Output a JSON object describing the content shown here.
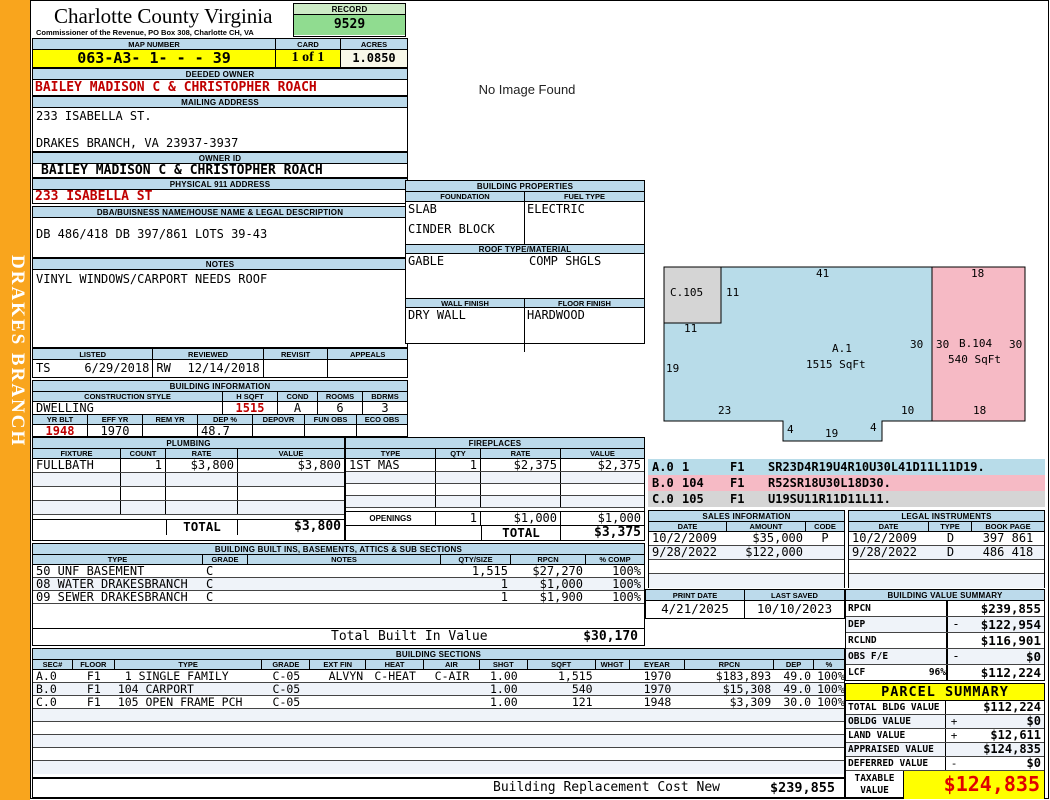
{
  "district": "DRAKES BRANCH",
  "no_image_text": "No Image Found",
  "header": {
    "county": "Charlotte County Virginia",
    "commissioner": "Commissioner of the Revenue, PO Box 308, Charlotte CH, VA",
    "record_label": "RECORD",
    "record_value": "9529",
    "map_label": "MAP NUMBER",
    "map_value": "063-A3- 1-  -  - 39",
    "card_label": "CARD",
    "card_value": "1 of 1",
    "acres_label": "ACRES",
    "acres_value": "1.0850"
  },
  "owner": {
    "deeded_label": "DEEDED OWNER",
    "deeded_value": "BAILEY MADISON C & CHRISTOPHER ROACH",
    "mailing_label": "MAILING ADDRESS",
    "mailing_line1": "233 ISABELLA ST.",
    "mailing_line2": "DRAKES BRANCH, VA 23937-3937",
    "owner_id_label": "OWNER ID",
    "owner_id_value": "BAILEY MADISON C & CHRISTOPHER ROACH",
    "physical_label": "PHYSICAL 911 ADDRESS",
    "physical_value": "233 ISABELLA ST",
    "legal_label": "DBA/BUISNESS NAME/HOUSE NAME & LEGAL DESCRIPTION",
    "legal_value": "DB 486/418 DB 397/861 LOTS 39-43",
    "notes_label": "NOTES",
    "notes_value": "VINYL WINDOWS/CARPORT NEEDS ROOF"
  },
  "visits": {
    "listed_label": "LISTED",
    "reviewed_label": "REVIEWED",
    "revisit_label": "REVISIT",
    "appeals_label": "APPEALS",
    "listed_by": "TS",
    "listed_date": "6/29/2018",
    "reviewed_by": "RW",
    "reviewed_date": "12/14/2018",
    "revisit_value": "",
    "appeals_value": ""
  },
  "building_info": {
    "band": "BUILDING INFORMATION",
    "style_label": "CONSTRUCTION STYLE",
    "hsqft_label": "H SQFT",
    "cond_label": "COND",
    "rooms_label": "ROOMS",
    "bdrms_label": "BDRMS",
    "style": "DWELLING",
    "hsqft": "1515",
    "cond": "A",
    "rooms": "6",
    "bdrms": "3",
    "yrblt_label": "YR BLT",
    "effyr_label": "EFF YR",
    "remyr_label": "REM YR",
    "dep_label": "DEP %",
    "depovr_label": "DEPOVR",
    "funobs_label": "FUN OBS",
    "ecoobs_label": "ECO OBS",
    "yrblt": "1948",
    "effyr": "1970",
    "remyr": "",
    "dep": "48.7",
    "depovr": "",
    "funobs": "",
    "ecoobs": ""
  },
  "plumbing": {
    "band": "PLUMBING",
    "headers": [
      "FIXTURE",
      "COUNT",
      "RATE",
      "VALUE"
    ],
    "rows": [
      {
        "fixture": "FULLBATH",
        "count": "1",
        "rate": "$3,800",
        "value": "$3,800"
      }
    ],
    "total_label": "TOTAL",
    "total_value": "$3,800"
  },
  "fireplaces": {
    "band": "FIREPLACES",
    "headers": [
      "TYPE",
      "QTY",
      "RATE",
      "VALUE"
    ],
    "rows": [
      {
        "type": "1ST MAS",
        "qty": "1",
        "rate": "$2,375",
        "value": "$2,375"
      }
    ],
    "openings_label": "OPENINGS",
    "openings_qty": "1",
    "openings_rate": "$1,000",
    "openings_value": "$1,000",
    "total_label": "TOTAL",
    "total_value": "$3,375"
  },
  "building_properties": {
    "band": "BUILDING PROPERTIES",
    "foundation_label": "FOUNDATION",
    "fuel_label": "FUEL TYPE",
    "foundation_line1": "SLAB",
    "foundation_line2": "CINDER BLOCK",
    "fuel": "ELECTRIC",
    "roof_label": "ROOF TYPE/MATERIAL",
    "roof_type": "GABLE",
    "roof_material": "COMP SHGLS",
    "wall_label": "WALL FINISH",
    "floor_label": "FLOOR FINISH",
    "wall": "DRY WALL",
    "floor": "HARDWOOD"
  },
  "built_ins": {
    "band": "BUILDING BUILT INS, BASEMENTS, ATTICS & SUB SECTIONS",
    "headers": [
      "TYPE",
      "GRADE",
      "NOTES",
      "QTY/SIZE",
      "RPCN",
      "% COMP"
    ],
    "rows": [
      {
        "type": "50 UNF BASEMENT",
        "grade": "C",
        "notes": "",
        "qty": "1,515",
        "rpcn": "$27,270",
        "comp": "100%"
      },
      {
        "type": "08 WATER DRAKESBRANCH",
        "grade": "C",
        "notes": "",
        "qty": "1",
        "rpcn": "$1,000",
        "comp": "100%"
      },
      {
        "type": "09 SEWER DRAKESBRANCH",
        "grade": "C",
        "notes": "",
        "qty": "1",
        "rpcn": "$1,900",
        "comp": "100%"
      }
    ],
    "total_label": "Total Built In Value",
    "total_value": "$30,170"
  },
  "sections": {
    "band": "BUILDING SECTIONS",
    "headers": [
      "SEC#",
      "FLOOR",
      "TYPE",
      "GRADE",
      "EXT FIN",
      "HEAT",
      "AIR",
      "SHGT",
      "SQFT",
      "WHGT",
      "EYEAR",
      "RPCN",
      "DEP",
      "% COMP"
    ],
    "rows": [
      {
        "sec": "A.0",
        "floor": "F1",
        "type": "1 SINGLE FAMILY",
        "grade": "C-05",
        "ext": "ALVYN",
        "heat": "C-HEAT",
        "air": "C-AIR",
        "shgt": "1.00",
        "sqft": "1,515",
        "whgt": "",
        "eyear": "1970",
        "rpcn": "$183,893",
        "dep": "49.0",
        "comp": "100%"
      },
      {
        "sec": "B.0",
        "floor": "F1",
        "type": "104 CARPORT",
        "grade": "C-05",
        "ext": "",
        "heat": "",
        "air": "",
        "shgt": "1.00",
        "sqft": "540",
        "whgt": "",
        "eyear": "1970",
        "rpcn": "$15,308",
        "dep": "49.0",
        "comp": "100%"
      },
      {
        "sec": "C.0",
        "floor": "F1",
        "type": "105 OPEN FRAME PCH",
        "grade": "C-05",
        "ext": "",
        "heat": "",
        "air": "",
        "shgt": "1.00",
        "sqft": "121",
        "whgt": "",
        "eyear": "1948",
        "rpcn": "$3,309",
        "dep": "30.0",
        "comp": "100%"
      }
    ]
  },
  "replacement": {
    "label": "Building Replacement Cost New",
    "value": "$239,855"
  },
  "sketch": {
    "a_label": "A.1",
    "a_sqft": "1515 SqFt",
    "b_label": "B.104",
    "b_sqft": "540 SqFt",
    "c_label": "C.105",
    "dims": {
      "top_a": "41",
      "top_b": "18",
      "c_right": "11",
      "c_bottom": "11",
      "a_left": "19",
      "a_right": "30",
      "b_left": "30",
      "b_right": "30",
      "a_bottom_left": "23",
      "a_bottom_right": "10",
      "b_bottom": "18",
      "notch_left": "4",
      "notch_bottom": "19",
      "notch_right": "4"
    }
  },
  "vectors": [
    {
      "sec": "A.0",
      "code": "1",
      "floor": "F1",
      "path": "SR23D4R19U4R10U30L41D11L11D19."
    },
    {
      "sec": "B.0",
      "code": "104",
      "floor": "F1",
      "path": "R52SR18U30L18D30."
    },
    {
      "sec": "C.0",
      "code": "105",
      "floor": "F1",
      "path": "U19SU11R11D11L11."
    }
  ],
  "sales": {
    "band": "SALES INFORMATION",
    "headers": [
      "DATE",
      "AMOUNT",
      "CODE"
    ],
    "rows": [
      {
        "date": "10/2/2009",
        "amount": "$35,000",
        "code": "P"
      },
      {
        "date": "9/28/2022",
        "amount": "$122,000",
        "code": ""
      }
    ]
  },
  "legal": {
    "band": "LEGAL INSTRUMENTS",
    "headers": [
      "DATE",
      "TYPE",
      "BOOK PAGE"
    ],
    "rows": [
      {
        "date": "10/2/2009",
        "type": "D",
        "book": "397 861"
      },
      {
        "date": "9/28/2022",
        "type": "D",
        "book": "486 418"
      }
    ]
  },
  "print_info": {
    "print_label": "PRINT DATE",
    "print_date": "4/21/2025",
    "saved_label": "LAST SAVED",
    "saved_date": "10/10/2023"
  },
  "value_summary": {
    "band": "BUILDING VALUE SUMMARY",
    "rows": [
      {
        "label": "RPCN",
        "extra": "",
        "sign": "",
        "value": "$239,855"
      },
      {
        "label": "DEP",
        "extra": "",
        "sign": "-",
        "value": "$122,954"
      },
      {
        "label": "RCLND",
        "extra": "",
        "sign": "",
        "value": "$116,901"
      },
      {
        "label": "OBS F/E",
        "extra": "",
        "sign": "-",
        "value": "$0"
      },
      {
        "label": "LCF",
        "extra": "96%",
        "sign": "",
        "value": "$112,224"
      }
    ]
  },
  "parcel": {
    "band": "PARCEL SUMMARY",
    "rows": [
      {
        "label": "TOTAL BLDG VALUE",
        "sign": "",
        "value": "$112,224"
      },
      {
        "label": "OBLDG VALUE",
        "sign": "+",
        "value": "$0"
      },
      {
        "label": "LAND VALUE",
        "sign": "+",
        "value": "$12,611"
      },
      {
        "label": "APPRAISED VALUE",
        "sign": "",
        "value": "$124,835"
      },
      {
        "label": "DEFERRED VALUE",
        "sign": "-",
        "value": "$0"
      }
    ],
    "taxable_label": "TAXABLE VALUE",
    "taxable_value": "$124,835"
  },
  "colors": {
    "accent_orange": "#F9A51D",
    "band_blue": "#BCDAEB",
    "yellow": "#FFFF00",
    "record_green": "#90DC90",
    "alert_red": "#C00000",
    "sketch_blue": "#B8DCE9",
    "sketch_pink": "#F6BAC5",
    "sketch_gray": "#D5D5D5"
  }
}
